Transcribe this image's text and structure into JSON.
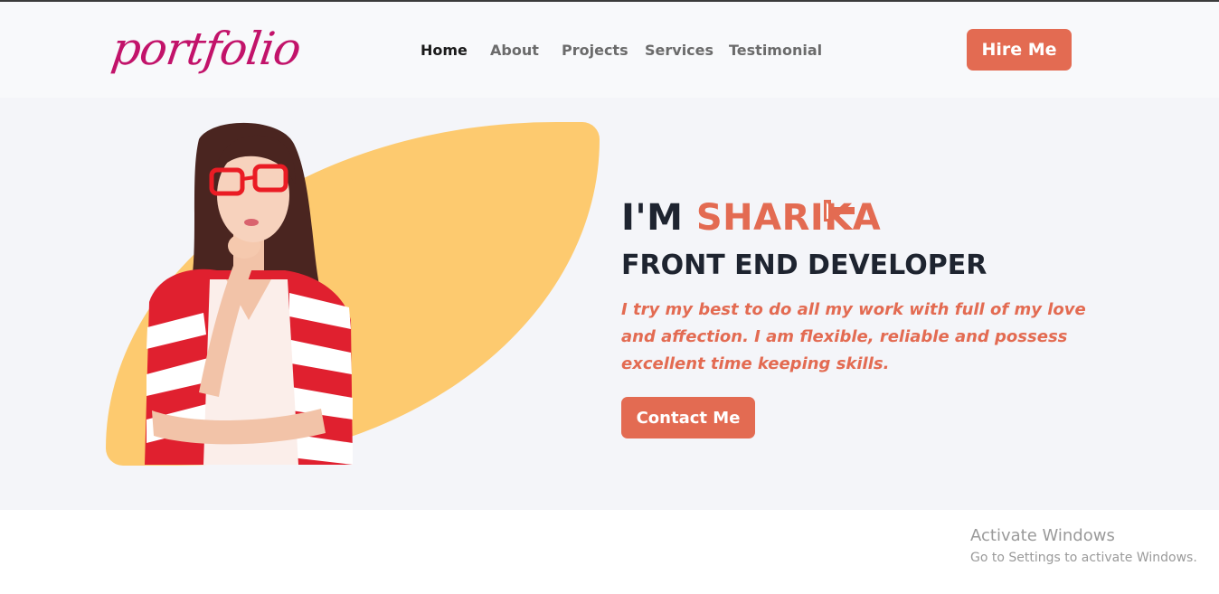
{
  "brand": {
    "logo_text": "portfolio",
    "color": "#c2136a"
  },
  "nav": {
    "items": [
      {
        "label": "Home",
        "active": true
      },
      {
        "label": "About"
      },
      {
        "label": "Projects"
      },
      {
        "label": "Services"
      },
      {
        "label": "Testimonial"
      }
    ],
    "cta_label": "Hire Me"
  },
  "hero": {
    "greeting": "I'M ",
    "name": "SHARIKA",
    "subtitle": "FRONT END DEVELOPER",
    "description": "I try my best to do all my work with full of my love and affection. I am flexible, reliable and possess excellent time keeping skills.",
    "cta_label": "Contact Me",
    "portrait_icon": "woman-portrait-image",
    "cursor_icon": "hand-pointer-icon"
  },
  "colors": {
    "accent": "#e36b52",
    "blob": "#fdca6f",
    "heading": "#1e2430",
    "nav_bg": "#f8f9fb",
    "hero_bg": "#f4f5f9"
  },
  "watermark": {
    "title": "Activate Windows",
    "subtitle": "Go to Settings to activate Windows."
  }
}
